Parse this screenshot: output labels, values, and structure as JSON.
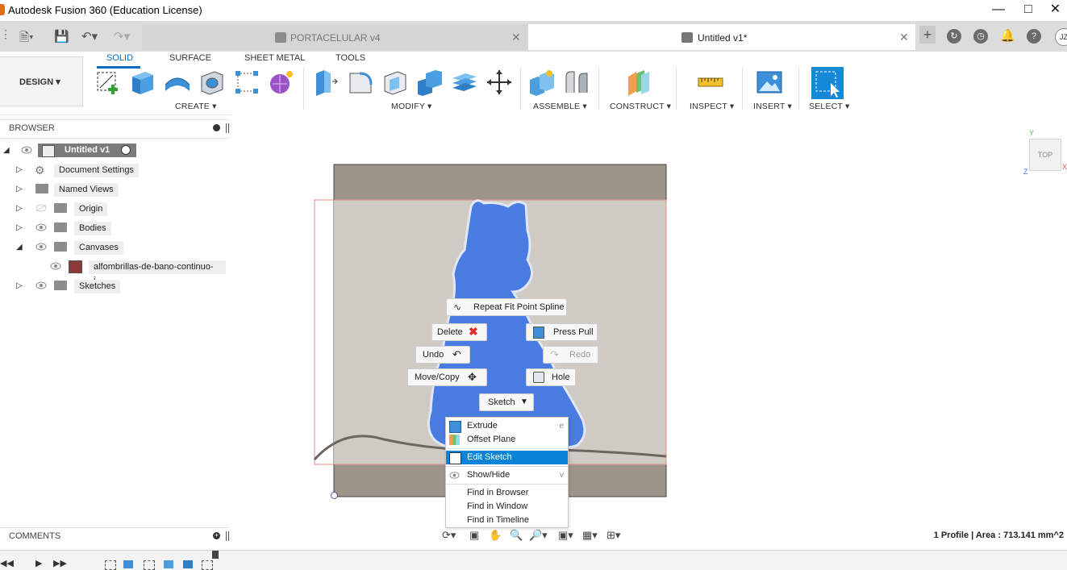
{
  "window": {
    "title": "Autodesk Fusion 360 (Education License)"
  },
  "tabs": [
    {
      "label": "PORTACELULAR v4"
    },
    {
      "label": "Untitled v1*"
    }
  ],
  "toolbar_right": {
    "user_initials": "JZ"
  },
  "workspace": {
    "label": "DESIGN"
  },
  "ribbon_tabs": [
    {
      "label": "SOLID"
    },
    {
      "label": "SURFACE"
    },
    {
      "label": "SHEET METAL"
    },
    {
      "label": "TOOLS"
    }
  ],
  "ribbon_groups": [
    {
      "label": "CREATE"
    },
    {
      "label": "MODIFY"
    },
    {
      "label": "ASSEMBLE"
    },
    {
      "label": "CONSTRUCT"
    },
    {
      "label": "INSPECT"
    },
    {
      "label": "INSERT"
    },
    {
      "label": "SELECT"
    }
  ],
  "browser": {
    "header": "BROWSER",
    "root": "Untitled v1",
    "nodes": [
      {
        "label": "Document Settings"
      },
      {
        "label": "Named Views"
      },
      {
        "label": "Origin"
      },
      {
        "label": "Bodies"
      },
      {
        "label": "Canvases"
      },
      {
        "label": "alfombrillas-de-bano-continuo-i..."
      },
      {
        "label": "Sketches"
      }
    ]
  },
  "viewcube": {
    "face": "TOP",
    "axis_y": "Y",
    "axis_x": "X",
    "axis_z": "Z"
  },
  "marking_menu": {
    "repeat": "Repeat Fit Point Spline",
    "delete": "Delete",
    "press_pull": "Press Pull",
    "undo": "Undo",
    "redo": "Redo",
    "move_copy": "Move/Copy",
    "hole": "Hole",
    "sketch": "Sketch"
  },
  "context_menu": {
    "items": [
      {
        "label": "Extrude",
        "shortcut": "e"
      },
      {
        "label": "Offset Plane",
        "shortcut": ""
      },
      {
        "label": "Edit Sketch",
        "shortcut": ""
      },
      {
        "label": "Show/Hide",
        "shortcut": "v"
      },
      {
        "label": "Find in Browser",
        "shortcut": ""
      },
      {
        "label": "Find in Window",
        "shortcut": ""
      },
      {
        "label": "Find in Timeline",
        "shortcut": ""
      }
    ]
  },
  "comments": {
    "header": "COMMENTS"
  },
  "status": {
    "text": "1 Profile | Area : 713.141 mm^2"
  },
  "colors": {
    "accent": "#0b6bbd",
    "selection": "#0b83d6",
    "profile": "#4a7be0",
    "canvas_bg": "#9e958a"
  }
}
